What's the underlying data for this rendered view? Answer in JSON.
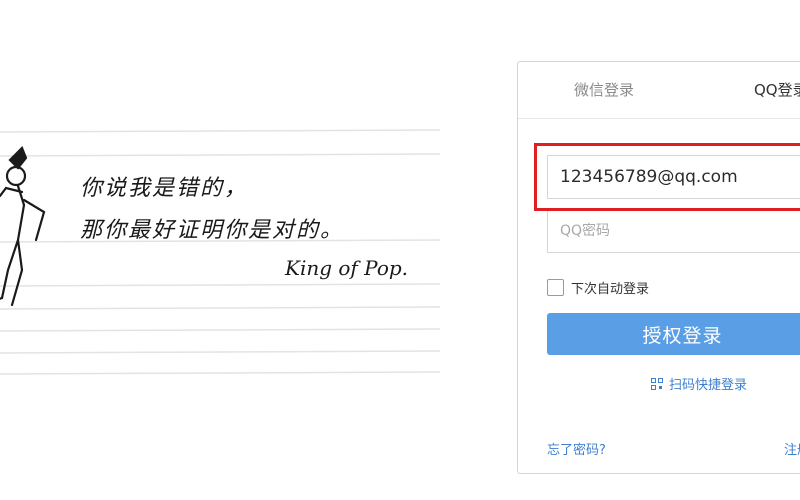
{
  "art": {
    "line1": "你说我是错的，",
    "line2": "那你最好证明你是对的。",
    "signature": "King of Pop."
  },
  "login": {
    "tabs": [
      {
        "label": "微信登录"
      },
      {
        "label": "QQ登录"
      }
    ],
    "account": {
      "value": "123456789@qq.com"
    },
    "password": {
      "placeholder": "QQ密码"
    },
    "remember_label": "下次自动登录",
    "authorize_button": "授权登录",
    "scan_login": "扫码快捷登录",
    "forgot_password": "忘了密码?",
    "register": "注册"
  },
  "colors": {
    "highlight": "#e02020",
    "button": "#5a9ee6",
    "link": "#3f7fcf"
  },
  "icons": {
    "scan": "qr-scan-icon",
    "figure": "dancer-sketch-icon"
  }
}
